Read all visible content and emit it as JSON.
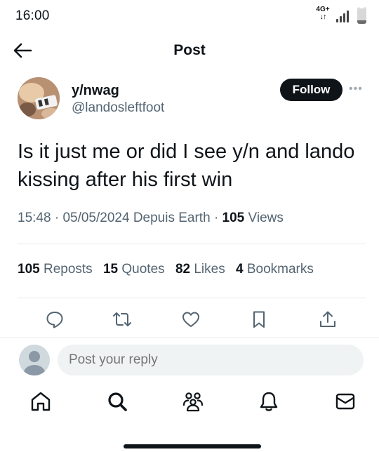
{
  "status_bar": {
    "time": "16:00",
    "network": "4G+",
    "network_arrows": "↓↑",
    "battery_fraction": 0.2
  },
  "header": {
    "title": "Post"
  },
  "author": {
    "display_name": "y/nwag",
    "handle": "@landosleftfoot"
  },
  "follow_label": "Follow",
  "more_label": "•••",
  "tweet": {
    "text": "Is it just me or did I see y/n and lando kissing after his first win",
    "time": "15:48",
    "date": "05/05/2024",
    "location": "Depuis Earth",
    "views_count": "105",
    "views_label": "Views",
    "separator": "·"
  },
  "stats": {
    "reposts": {
      "count": "105",
      "label": "Reposts"
    },
    "quotes": {
      "count": "15",
      "label": "Quotes"
    },
    "likes": {
      "count": "82",
      "label": "Likes"
    },
    "bookmarks": {
      "count": "4",
      "label": "Bookmarks"
    }
  },
  "actions": [
    "reply-icon",
    "repost-icon",
    "like-icon",
    "bookmark-icon",
    "share-icon"
  ],
  "reply": {
    "placeholder": "Post your reply"
  },
  "bottom_nav": [
    "home-icon",
    "search-icon",
    "communities-icon",
    "notifications-icon",
    "messages-icon"
  ],
  "colors": {
    "text": "#0f1419",
    "secondary": "#536471",
    "divider": "#e6e9eb",
    "input_bg": "#eff3f4"
  }
}
